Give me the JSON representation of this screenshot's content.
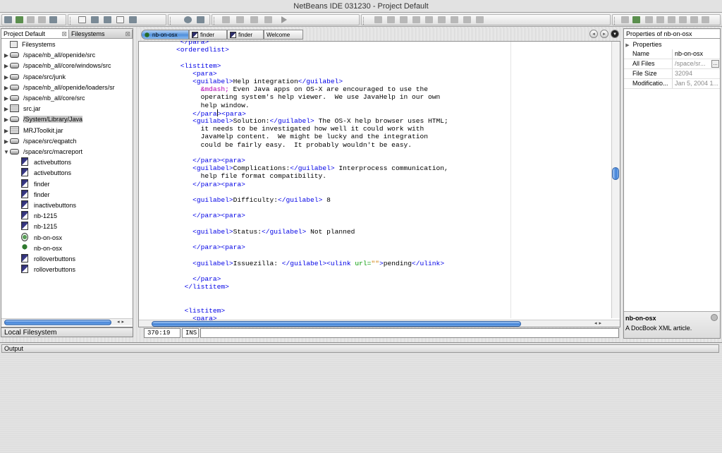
{
  "window": {
    "title": "NetBeans IDE 031230 - Project Default"
  },
  "explorer": {
    "tabs": [
      "Project Default",
      "Filesystems"
    ],
    "items": [
      {
        "label": "Filesystems",
        "icon": "filesystems-icon",
        "level": 0,
        "expander": ""
      },
      {
        "label": "/space/nb_all/openide/src",
        "icon": "drive-icon",
        "level": 0,
        "expander": "▶"
      },
      {
        "label": "/space/nb_all/core/windows/src",
        "icon": "drive-icon",
        "level": 0,
        "expander": "▶"
      },
      {
        "label": "/space/src/junk",
        "icon": "drive-icon",
        "level": 0,
        "expander": "▶"
      },
      {
        "label": "/space/nb_all/openide/loaders/sr",
        "icon": "drive-icon",
        "level": 0,
        "expander": "▶"
      },
      {
        "label": "/space/nb_all/core/src",
        "icon": "drive-icon",
        "level": 0,
        "expander": "▶"
      },
      {
        "label": "src.jar",
        "icon": "jar-icon",
        "level": 0,
        "expander": "▶"
      },
      {
        "label": "/System/Library/Java",
        "icon": "drive-icon",
        "level": 0,
        "expander": "▶",
        "selected": true
      },
      {
        "label": "MRJToolkit.jar",
        "icon": "jar-icon",
        "level": 0,
        "expander": "▶"
      },
      {
        "label": "/space/src/eqpatch",
        "icon": "drive-icon",
        "level": 0,
        "expander": "▶"
      },
      {
        "label": "/space/src/macreport",
        "icon": "drive-icon",
        "level": 0,
        "expander": "▼"
      },
      {
        "label": "activebuttons",
        "icon": "image-file-icon",
        "level": 1,
        "expander": ""
      },
      {
        "label": "activebuttons",
        "icon": "image-file-icon",
        "level": 1,
        "expander": ""
      },
      {
        "label": "finder",
        "icon": "image-file-icon",
        "level": 1,
        "expander": ""
      },
      {
        "label": "finder",
        "icon": "image-file-icon",
        "level": 1,
        "expander": ""
      },
      {
        "label": "inactivebuttons",
        "icon": "image-file-icon",
        "level": 1,
        "expander": ""
      },
      {
        "label": "nb-1215",
        "icon": "image-file-icon",
        "level": 1,
        "expander": ""
      },
      {
        "label": "nb-1215",
        "icon": "image-file-icon",
        "level": 1,
        "expander": ""
      },
      {
        "label": "nb-on-osx",
        "icon": "xml-file-icon",
        "level": 1,
        "expander": ""
      },
      {
        "label": "nb-on-osx",
        "icon": "docbook-file-icon",
        "level": 1,
        "expander": ""
      },
      {
        "label": "rolloverbuttons",
        "icon": "image-file-icon",
        "level": 1,
        "expander": ""
      },
      {
        "label": "rolloverbuttons",
        "icon": "image-file-icon",
        "level": 1,
        "expander": ""
      }
    ],
    "status": "Local Filesystem"
  },
  "editor": {
    "tabs": [
      "nb-on-osx",
      "finder",
      "finder",
      "Welcome"
    ],
    "lines": [
      {
        "indent": 10,
        "parts": [
          [
            "t",
            "</para>"
          ]
        ]
      },
      {
        "indent": 8,
        "parts": [
          [
            "t",
            "<orderedlist>"
          ]
        ]
      },
      {
        "indent": 0,
        "parts": []
      },
      {
        "indent": 10,
        "parts": [
          [
            "t",
            "<listitem>"
          ]
        ]
      },
      {
        "indent": 16,
        "parts": [
          [
            "t",
            "<para>"
          ]
        ]
      },
      {
        "indent": 16,
        "parts": [
          [
            "t",
            "<guilabel>"
          ],
          [
            "",
            "Help integration"
          ],
          [
            "t",
            "</guilabel>"
          ]
        ]
      },
      {
        "indent": 20,
        "parts": [
          [
            "e",
            "&mdash;"
          ],
          [
            "",
            " Even Java apps on OS-X are encouraged to use the"
          ]
        ]
      },
      {
        "indent": 20,
        "parts": [
          [
            "",
            "operating system's help viewer.  We use JavaHelp in our own"
          ]
        ]
      },
      {
        "indent": 20,
        "parts": [
          [
            "",
            "help window."
          ]
        ]
      },
      {
        "indent": 16,
        "parts": [
          [
            "t",
            "</para"
          ],
          [
            "cursor",
            ""
          ],
          [
            "t",
            "><para>"
          ]
        ]
      },
      {
        "indent": 16,
        "parts": [
          [
            "t",
            "<guilabel>"
          ],
          [
            "",
            "Solution:"
          ],
          [
            "t",
            "</guilabel>"
          ],
          [
            "",
            " The OS-X help browser uses HTML;"
          ]
        ]
      },
      {
        "indent": 20,
        "parts": [
          [
            "",
            "it needs to be investigated how well it could work with"
          ]
        ]
      },
      {
        "indent": 20,
        "parts": [
          [
            "",
            "JavaHelp content.  We might be lucky and the integration"
          ]
        ]
      },
      {
        "indent": 20,
        "parts": [
          [
            "",
            "could be fairly easy.  It probably wouldn't be easy."
          ]
        ]
      },
      {
        "indent": 0,
        "parts": []
      },
      {
        "indent": 16,
        "parts": [
          [
            "t",
            "</para><para>"
          ]
        ]
      },
      {
        "indent": 16,
        "parts": [
          [
            "t",
            "<guilabel>"
          ],
          [
            "",
            "Complications:"
          ],
          [
            "t",
            "</guilabel>"
          ],
          [
            "",
            " Interprocess communication,"
          ]
        ]
      },
      {
        "indent": 20,
        "parts": [
          [
            "",
            "help file format compatibility."
          ]
        ]
      },
      {
        "indent": 16,
        "parts": [
          [
            "t",
            "</para><para>"
          ]
        ]
      },
      {
        "indent": 0,
        "parts": []
      },
      {
        "indent": 16,
        "parts": [
          [
            "t",
            "<guilabel>"
          ],
          [
            "",
            "Difficulty:"
          ],
          [
            "t",
            "</guilabel>"
          ],
          [
            "",
            " 8"
          ]
        ]
      },
      {
        "indent": 0,
        "parts": []
      },
      {
        "indent": 16,
        "parts": [
          [
            "t",
            "</para><para>"
          ]
        ]
      },
      {
        "indent": 0,
        "parts": []
      },
      {
        "indent": 16,
        "parts": [
          [
            "t",
            "<guilabel>"
          ],
          [
            "",
            "Status:"
          ],
          [
            "t",
            "</guilabel>"
          ],
          [
            "",
            " Not planned"
          ]
        ]
      },
      {
        "indent": 0,
        "parts": []
      },
      {
        "indent": 16,
        "parts": [
          [
            "t",
            "</para><para>"
          ]
        ]
      },
      {
        "indent": 0,
        "parts": []
      },
      {
        "indent": 16,
        "parts": [
          [
            "t",
            "<guilabel>"
          ],
          [
            "",
            "Issuezilla: "
          ],
          [
            "t",
            "</guilabel><ulink "
          ],
          [
            "a",
            "url="
          ],
          [
            "s",
            "\"\""
          ],
          [
            "t",
            ">"
          ],
          [
            "",
            "pending"
          ],
          [
            "t",
            "</ulink>"
          ]
        ]
      },
      {
        "indent": 0,
        "parts": []
      },
      {
        "indent": 16,
        "parts": [
          [
            "t",
            "</para>"
          ]
        ]
      },
      {
        "indent": 12,
        "parts": [
          [
            "t",
            "</listitem>"
          ]
        ]
      },
      {
        "indent": 0,
        "parts": []
      },
      {
        "indent": 0,
        "parts": []
      },
      {
        "indent": 12,
        "parts": [
          [
            "t",
            "<listitem>"
          ]
        ]
      },
      {
        "indent": 16,
        "parts": [
          [
            "t",
            "<para>"
          ]
        ]
      }
    ],
    "status": {
      "position": "370:19",
      "mode": "INS"
    }
  },
  "properties": {
    "title": "Properties of nb-on-osx",
    "section": "Properties",
    "rows": [
      {
        "key": "Name",
        "value": "nb-on-osx",
        "readonly": false,
        "button": false
      },
      {
        "key": "All Files",
        "value": "/space/sr...",
        "readonly": true,
        "button": true
      },
      {
        "key": "File Size",
        "value": "32094",
        "readonly": true,
        "button": false
      },
      {
        "key": "Modificatio...",
        "value": "Jan 5, 2004 1...",
        "readonly": true,
        "button": false
      }
    ],
    "description_title": "nb-on-osx",
    "description_text": "A DocBook XML article."
  },
  "output": {
    "label": "Output"
  },
  "icons": {
    "toolbar": [
      "new-icon",
      "run-icon",
      "debug-icon",
      "build-icon",
      "find-icon",
      "open-icon",
      "save-icon"
    ],
    "nav_prev": "◂",
    "nav_next": "▸",
    "nav_menu": "▾"
  }
}
